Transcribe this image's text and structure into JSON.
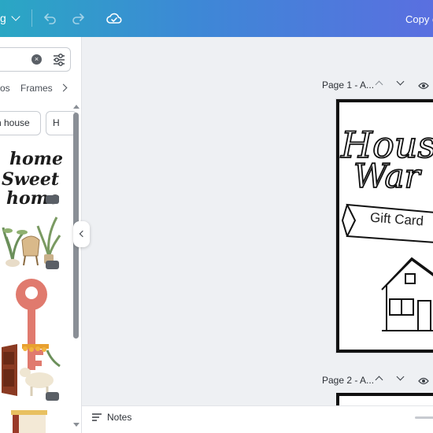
{
  "topbar": {
    "menu_label": "g",
    "copy_label": "Copy c"
  },
  "panel": {
    "search": {
      "clear_glyph": "×"
    },
    "tabs": [
      {
        "label": "os"
      },
      {
        "label": "Frames"
      }
    ],
    "chips": [
      {
        "label": "n house"
      },
      {
        "label": "H"
      }
    ],
    "results": [
      {
        "name": "home-sweet-home-lettering",
        "text": [
          "home",
          "Sweet",
          "home"
        ]
      },
      {
        "name": "boho-chair-plants"
      },
      {
        "name": "red-key"
      },
      {
        "name": "door-with-cow"
      },
      {
        "name": "partial-item"
      }
    ]
  },
  "pages": [
    {
      "title": "Page 1 - A..."
    },
    {
      "title": "Page 2 - A..."
    }
  ],
  "design": {
    "headline": [
      "House",
      "War"
    ],
    "ribbon_text": "Gift Card"
  },
  "bottombar": {
    "notes_label": "Notes"
  },
  "colors": {
    "topbar_start": "#2aa7c4",
    "topbar_end": "#5a6fe0",
    "key_red": "#e07a6e"
  }
}
